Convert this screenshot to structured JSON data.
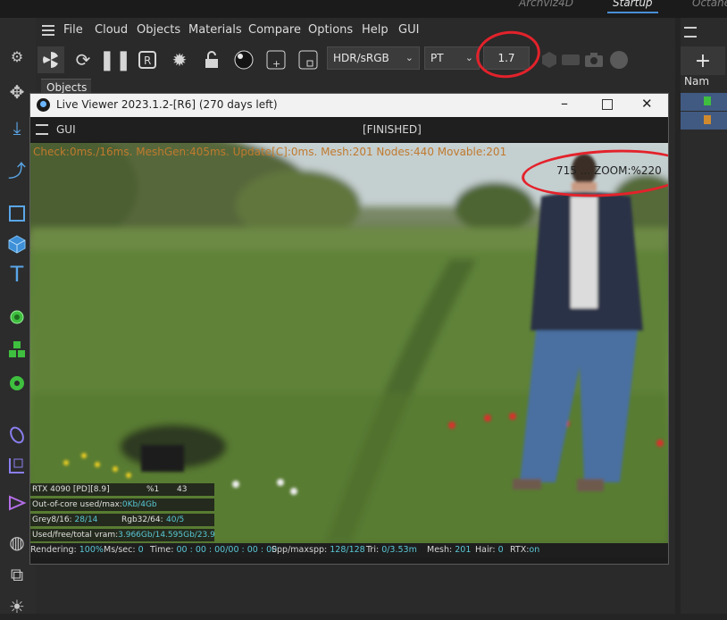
{
  "top_tabs": [
    {
      "label": "Archviz4D",
      "active": false
    },
    {
      "label": "Startup",
      "active": true
    },
    {
      "label": "Octane",
      "active": false
    }
  ],
  "menu": [
    "File",
    "Cloud",
    "Objects",
    "Materials",
    "Compare",
    "Options",
    "Help",
    "GUI"
  ],
  "toolbar": {
    "color_space": "HDR/sRGB",
    "kernel": "PT",
    "value_field": "1.7"
  },
  "objects_tab": "Objects",
  "right_panel": {
    "plus": "+",
    "name_header": "Nam"
  },
  "live_viewer": {
    "title": "Live Viewer 2023.1.2-[R6] (270 days left)",
    "gui_label": "GUI",
    "state": "[FINISHED]",
    "stats_line": "Check:0ms./16ms. MeshGen:405ms. Update[C]:0ms. Mesh:201 Nodes:440 Movable:201",
    "zoom_text": "715 ... ZOOM:%220",
    "gpu": {
      "name": "RTX 4090 [PD][8.9]",
      "percent": "%1",
      "temp": "43"
    },
    "out_of_core": {
      "label": "Out-of-core used/max:",
      "value": "0Kb/4Gb"
    },
    "grey": {
      "label": "Grey8/16:",
      "value": "28/14",
      "rgb_label": "Rgb32/64:",
      "rgb_value": "40/5"
    },
    "vram": {
      "label": "Used/free/total vram:",
      "value": "3.966Gb/14.595Gb/23.9"
    },
    "status": {
      "rendering_label": "Rendering:",
      "rendering": "100%",
      "ms_label": "Ms/sec:",
      "ms": "0",
      "time_label": "Time:",
      "time": "00 : 00 : 00/00 : 00 : 00",
      "spp_label": "Spp/maxspp:",
      "spp": "128/128",
      "tri_label": "Tri:",
      "tri": "0/3.53m",
      "mesh_label": "Mesh:",
      "mesh": "201",
      "hair_label": "Hair:",
      "hair": "0",
      "rtx_label": "RTX:",
      "rtx": "on"
    }
  },
  "colors": {
    "accent": "#4a8fd8",
    "annotation": "#e3222b",
    "cyan": "#59c7d6"
  }
}
